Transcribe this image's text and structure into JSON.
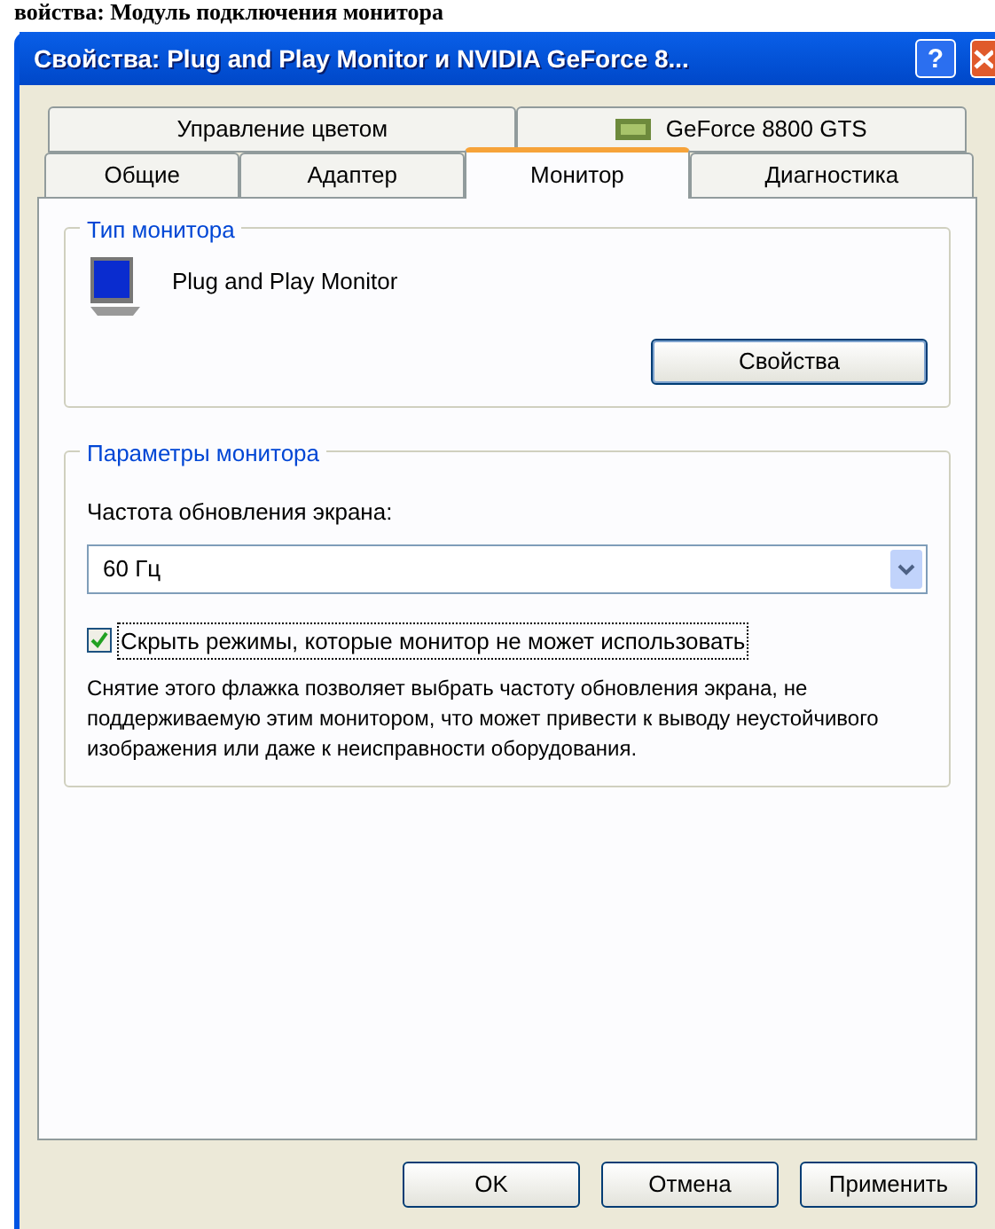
{
  "page_heading": "войства: Модуль подключения монитора",
  "window": {
    "title": "Свойства: Plug and Play Monitor и NVIDIA GeForce 8...",
    "help_button": "?"
  },
  "tab_rows": [
    [
      {
        "label": "Управление цветом",
        "kind": "text",
        "selected": false
      },
      {
        "label": "GeForce 8800 GTS",
        "kind": "icon",
        "selected": false
      }
    ],
    [
      {
        "label": "Общие",
        "kind": "text",
        "selected": false
      },
      {
        "label": "Адаптер",
        "kind": "text",
        "selected": false
      },
      {
        "label": "Монитор",
        "kind": "text",
        "selected": true
      },
      {
        "label": "Диагностика",
        "kind": "text",
        "selected": false
      }
    ]
  ],
  "monitor_type": {
    "legend": "Тип монитора",
    "name": "Plug and Play Monitor",
    "button": "Свойства"
  },
  "monitor_settings": {
    "legend": "Параметры монитора",
    "refresh_label": "Частота обновления экрана:",
    "refresh_value": "60 Гц",
    "checkbox": {
      "label": "Скрыть режимы, которые монитор не может использовать",
      "checked": true
    },
    "note": "Снятие этого флажка позволяет выбрать частоту обновления экрана, не поддерживаемую этим монитором, что может привести к выводу неустойчивого изображения или даже к неисправности оборудования."
  },
  "buttons": [
    "OK",
    "Отмена",
    "Применить"
  ]
}
